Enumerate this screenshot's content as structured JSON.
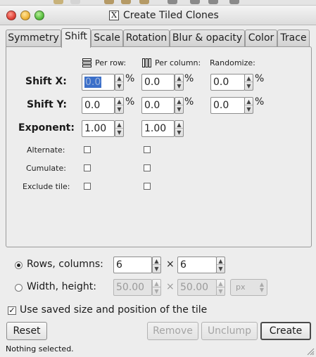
{
  "window": {
    "title": "Create Tiled Clones"
  },
  "tabs": [
    {
      "label": "Symmetry"
    },
    {
      "label": "Shift"
    },
    {
      "label": "Scale"
    },
    {
      "label": "Rotation"
    },
    {
      "label": "Blur & opacity"
    },
    {
      "label": "Color"
    },
    {
      "label": "Trace"
    }
  ],
  "shift": {
    "per_row": "Per row:",
    "per_column": "Per column:",
    "randomize": "Randomize:",
    "shift_x_label": "Shift X:",
    "shift_y_label": "Shift Y:",
    "exponent_label": "Exponent:",
    "alternate_label": "Alternate:",
    "cumulate_label": "Cumulate:",
    "exclude_tile_label": "Exclude tile:",
    "percent": "%",
    "shift_x": {
      "row": "0.0",
      "column": "0.0",
      "random": "0.0"
    },
    "shift_y": {
      "row": "0.0",
      "column": "0.0",
      "random": "0.0"
    },
    "exponent": {
      "row": "1.00",
      "column": "1.00"
    },
    "alternate": {
      "row": false,
      "column": false
    },
    "cumulate": {
      "row": false,
      "column": false
    },
    "exclude_tile": {
      "row": false,
      "column": false
    }
  },
  "size": {
    "rows_columns_label": "Rows, columns:",
    "width_height_label": "Width, height:",
    "rows": "6",
    "columns": "6",
    "times": "×",
    "width": "50.00",
    "height": "50.00",
    "unit": "px",
    "mode": "rows_columns"
  },
  "use_saved_label": "Use saved size and position of the tile",
  "use_saved_checked": true,
  "buttons": {
    "reset": "Reset",
    "remove": "Remove",
    "unclump": "Unclump",
    "create": "Create"
  },
  "status": "Nothing selected.",
  "colors": {
    "selection": "#3b6fc9",
    "background": "#ededed"
  }
}
